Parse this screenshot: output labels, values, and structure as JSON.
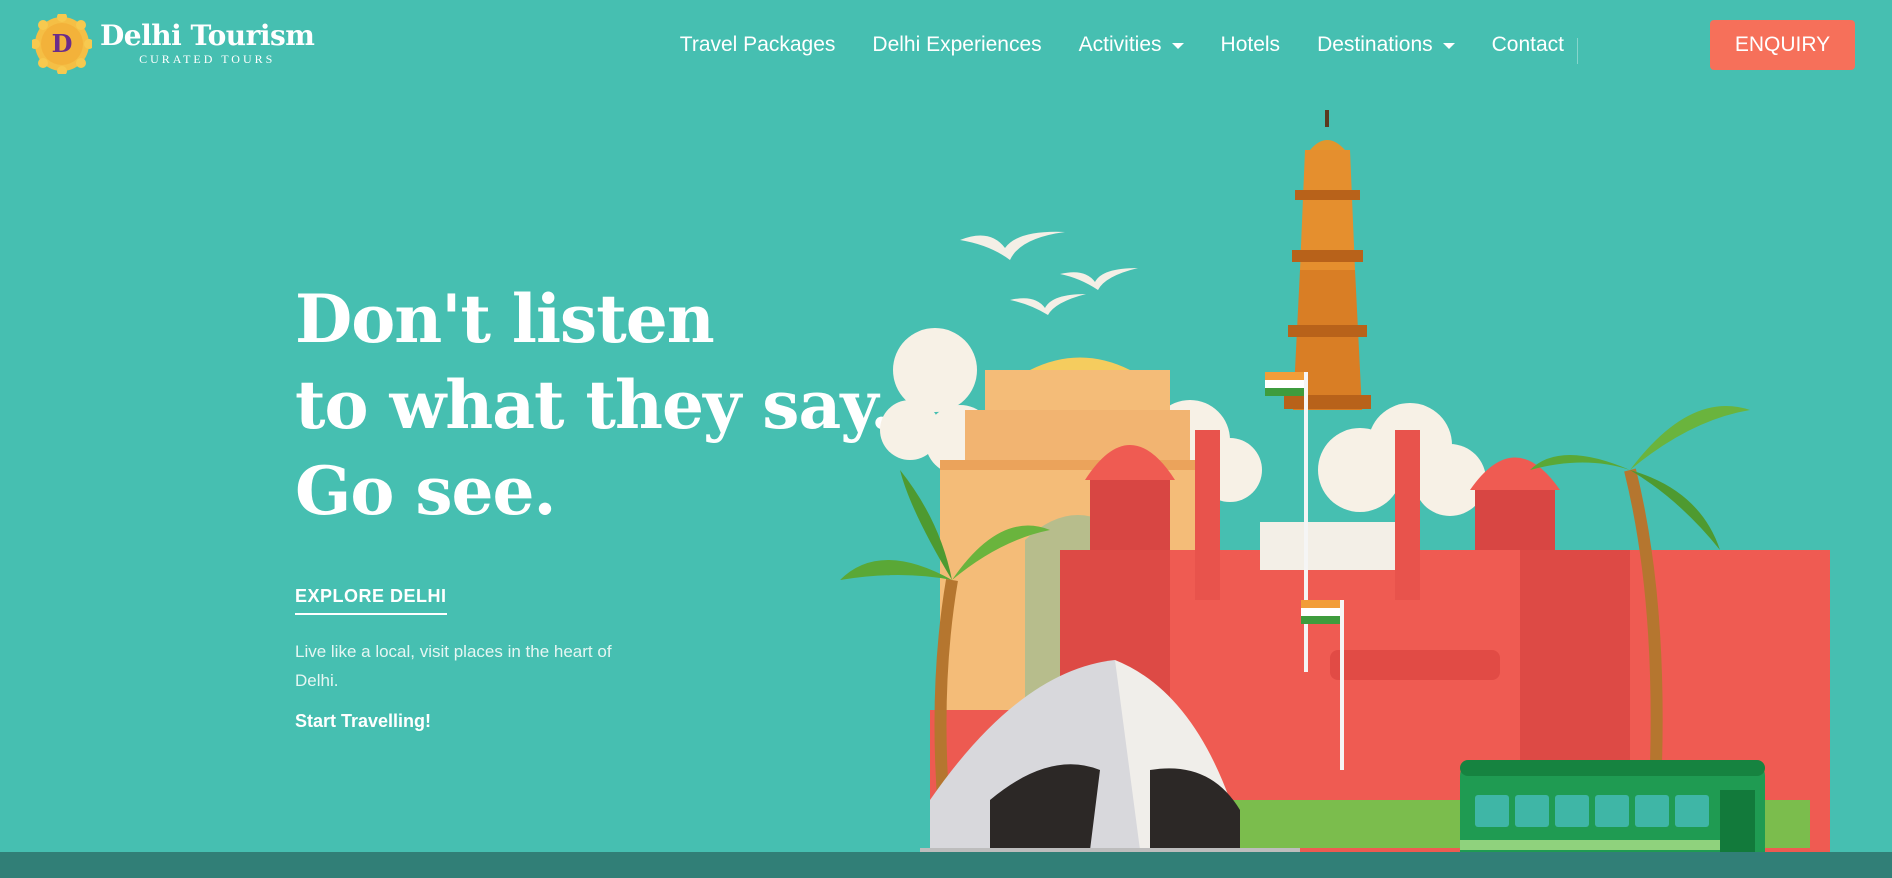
{
  "logo": {
    "badge_letter": "D",
    "title": "Delhi Tourism",
    "subtitle": "CURATED TOURS"
  },
  "nav": {
    "items": [
      {
        "label": "Travel Packages",
        "has_dropdown": false
      },
      {
        "label": "Delhi Experiences",
        "has_dropdown": false
      },
      {
        "label": "Activities",
        "has_dropdown": true
      },
      {
        "label": "Hotels",
        "has_dropdown": false
      },
      {
        "label": "Destinations",
        "has_dropdown": true
      },
      {
        "label": "Contact",
        "has_dropdown": false
      }
    ],
    "cta_label": "ENQUIRY"
  },
  "hero": {
    "title_lines": [
      "Don't listen",
      "to what they say.",
      "Go see."
    ],
    "explore_link": "EXPLORE DELHI",
    "description": "Live like a local, visit places in the heart of Delhi.",
    "start_link": "Start Travelling!"
  },
  "colors": {
    "background": "#46bfb1",
    "accent": "#f6705a",
    "footer": "#317f77"
  },
  "illustration": {
    "icon": "delhi-landmarks-illustration"
  }
}
